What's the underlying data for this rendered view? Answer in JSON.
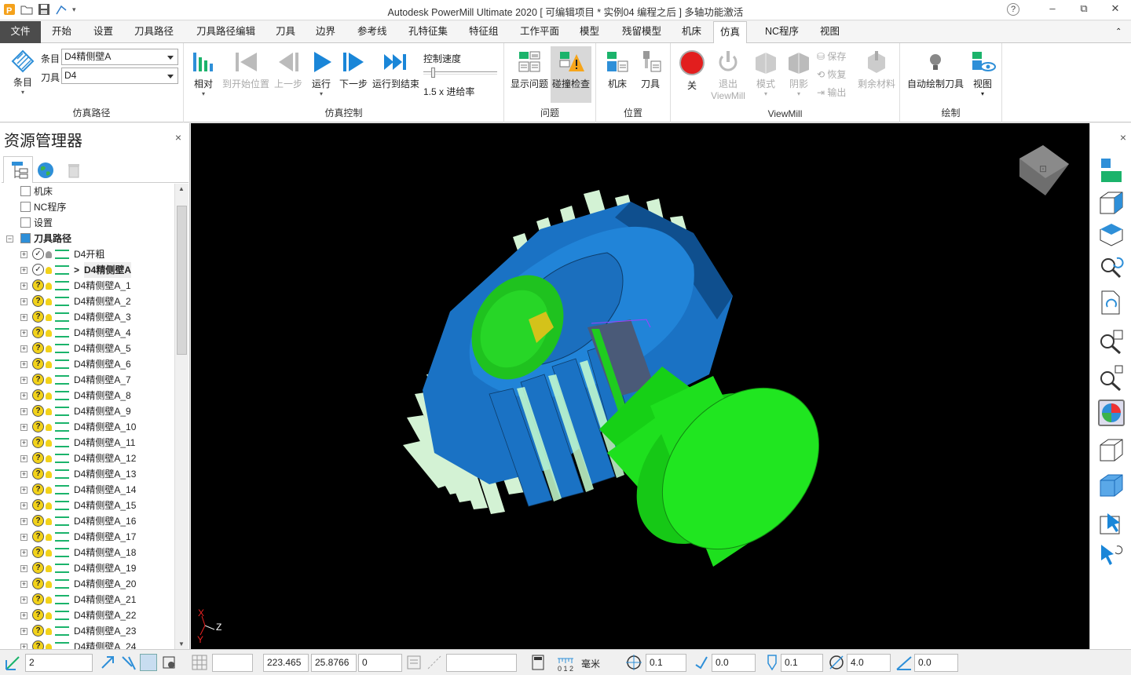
{
  "title_bar": {
    "title": "Autodesk PowerMill Ultimate 2020   [ 可编辑项目 * 实例04 编程之后 ]     多轴功能激活",
    "help": "?",
    "min": "–",
    "restore": "⧉",
    "close": "✕"
  },
  "menu": {
    "file": "文件",
    "tabs": [
      "开始",
      "设置",
      "刀具路径",
      "刀具路径编辑",
      "刀具",
      "边界",
      "参考线",
      "孔特征集",
      "特征组",
      "工作平面",
      "模型",
      "残留模型",
      "机床",
      "仿真",
      "NC程序",
      "视图"
    ],
    "active": "仿真",
    "collapse": "⌃"
  },
  "ribbon": {
    "sim_path": {
      "label": "仿真路径",
      "entry_btn": "条目",
      "entry_label": "条目",
      "entry_value": "D4精侧壁A",
      "tool_label": "刀具",
      "tool_value": "D4"
    },
    "sim_control": {
      "label": "仿真控制",
      "relative": "相对",
      "to_start": "到开始位置",
      "prev": "上一步",
      "run": "运行",
      "next": "下一步",
      "run_end": "运行到结束",
      "speed_label": "控制速度",
      "speed_value": "1.5 x 进给率"
    },
    "issues": {
      "label": "问题",
      "show": "显示问题",
      "collision": "碰撞检查"
    },
    "position": {
      "label": "位置",
      "machine": "机床",
      "tool": "刀具"
    },
    "viewmill": {
      "label": "ViewMill",
      "off": "关",
      "exit": "退出",
      "exit2": "ViewMill",
      "mode": "模式",
      "shade": "阴影",
      "save": "保存",
      "restore": "恢复",
      "output": "输出",
      "remaining": "剩余材料"
    },
    "draw": {
      "label": "绘制",
      "auto_draw": "自动绘制刀具",
      "view": "视图"
    }
  },
  "explorer": {
    "title": "资源管理器",
    "close": "×",
    "top_items": [
      "机床",
      "NC程序",
      "设置",
      "刀具路径"
    ],
    "toolpaths": [
      "D4开粗",
      "D4精侧壁A",
      "D4精侧壁A_1",
      "D4精侧壁A_2",
      "D4精侧壁A_3",
      "D4精侧壁A_4",
      "D4精侧壁A_5",
      "D4精侧壁A_6",
      "D4精侧壁A_7",
      "D4精侧壁A_8",
      "D4精侧壁A_9",
      "D4精侧壁A_10",
      "D4精侧壁A_11",
      "D4精侧壁A_12",
      "D4精侧壁A_13",
      "D4精侧壁A_14",
      "D4精侧壁A_15",
      "D4精侧壁A_16",
      "D4精侧壁A_17",
      "D4精侧壁A_18",
      "D4精侧壁A_19",
      "D4精侧壁A_20",
      "D4精侧壁A_21",
      "D4精侧壁A_22",
      "D4精侧壁A_23",
      "D4精侧壁A_24"
    ],
    "active_prefix": ">"
  },
  "viewport": {
    "axis_x": "X",
    "axis_y": "Y",
    "axis_z": "Z",
    "model_color": "#1a72c4",
    "part_color": "#1ee01e",
    "path_color": "#d8ffd0"
  },
  "rightbar": {
    "close": "×"
  },
  "status": {
    "workplane": "2",
    "coord_x": "223.465",
    "coord_y": "25.8766",
    "coord_z": "0",
    "unit": "毫米",
    "tol": "0.1",
    "thick": "0.0",
    "tool_dia_label": "0.1",
    "dia": "4.0",
    "angle": "0.0"
  }
}
